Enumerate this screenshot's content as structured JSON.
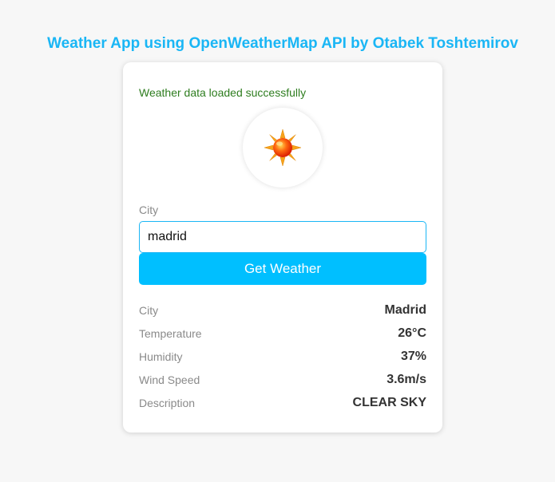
{
  "header": {
    "title": "Weather App using OpenWeatherMap API by Otabek Toshtemirov"
  },
  "status": {
    "message": "Weather data loaded successfully"
  },
  "weather_icon": {
    "name": "clear-sky-sun-icon"
  },
  "form": {
    "city_label": "City",
    "city_value": "madrid",
    "button_label": "Get Weather"
  },
  "details": [
    {
      "label": "City",
      "value": "Madrid"
    },
    {
      "label": "Temperature",
      "value": "26°C"
    },
    {
      "label": "Humidity",
      "value": "37%"
    },
    {
      "label": "Wind Speed",
      "value": "3.6m/s"
    },
    {
      "label": "Description",
      "value": "CLEAR SKY"
    }
  ],
  "colors": {
    "accent": "#00bfff",
    "title": "#1ab6f5",
    "success": "#2e7d1f"
  }
}
